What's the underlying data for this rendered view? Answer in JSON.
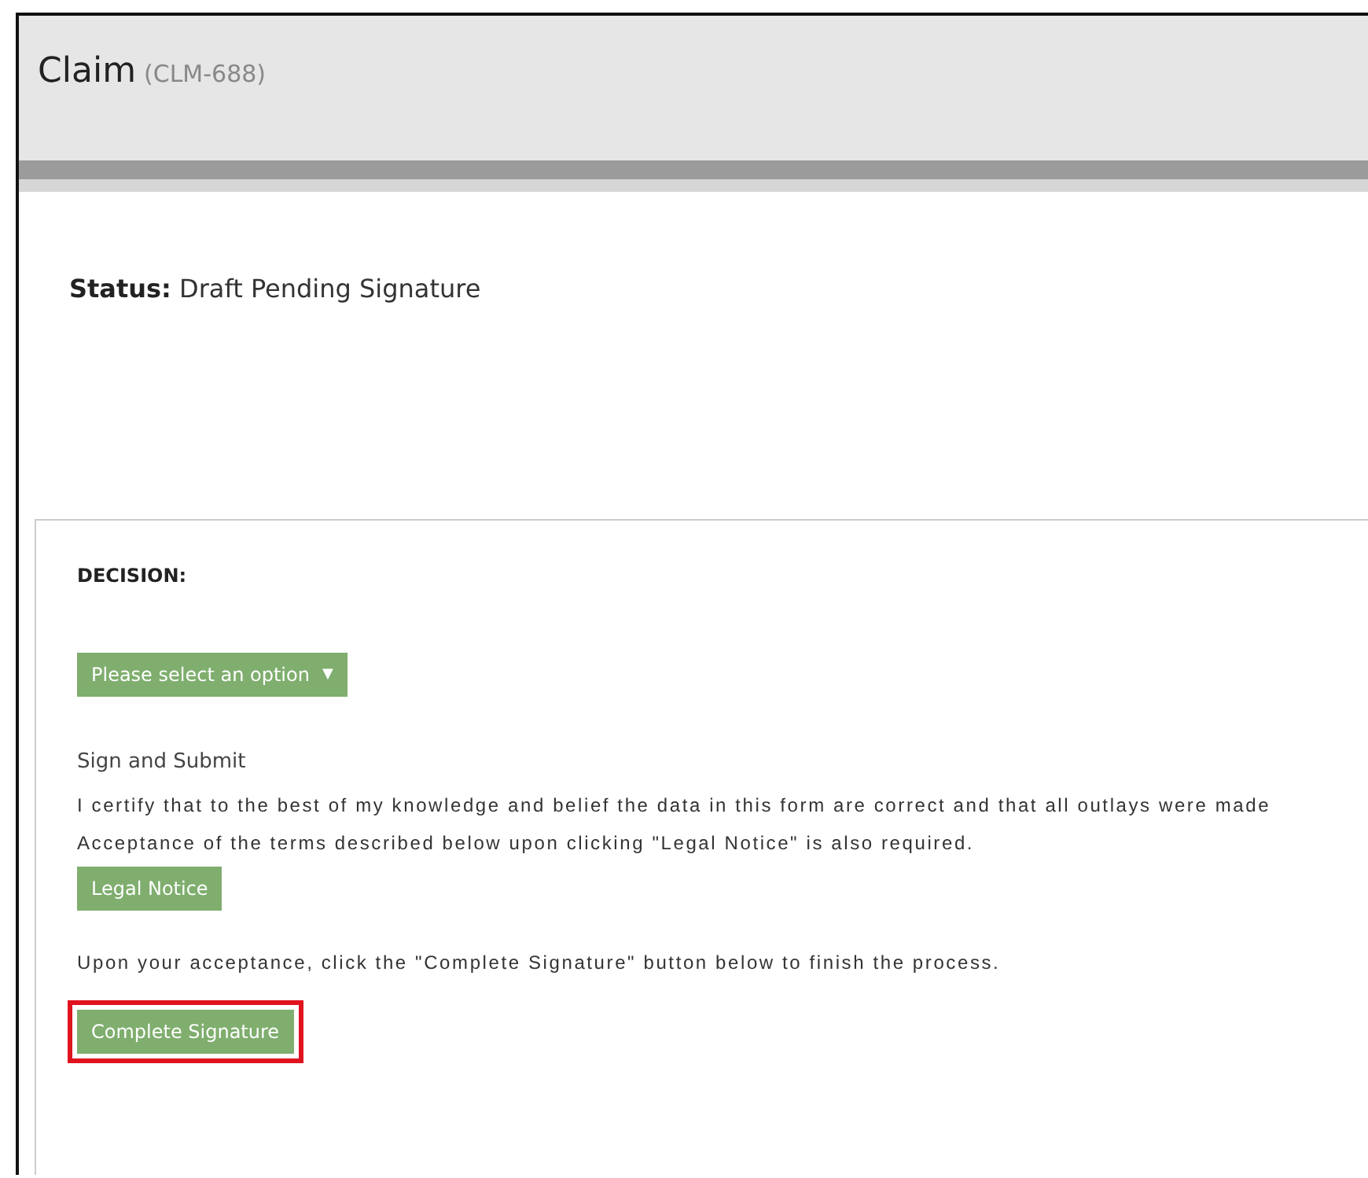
{
  "header": {
    "title": "Claim",
    "record_id": "(CLM-688)"
  },
  "status": {
    "label": "Status:",
    "value": "Draft Pending Signature"
  },
  "decision": {
    "label": "DECISION:",
    "dropdown": {
      "placeholder": "Please select an option",
      "caret": "▼"
    },
    "section_title": "Sign and Submit",
    "certify_text": "I certify that to the best of my knowledge and belief the data in this form are correct and that all outlays were made",
    "acceptance_text": "Acceptance of the terms described below upon clicking \"Legal Notice\" is also required.",
    "legal_button": {
      "label": "Legal Notice",
      "highlighted": false
    },
    "instruction_text": "Upon your acceptance, click the \"Complete Signature\" button below to finish the process.",
    "complete_button": {
      "label": "Complete Signature",
      "highlighted": true
    }
  }
}
